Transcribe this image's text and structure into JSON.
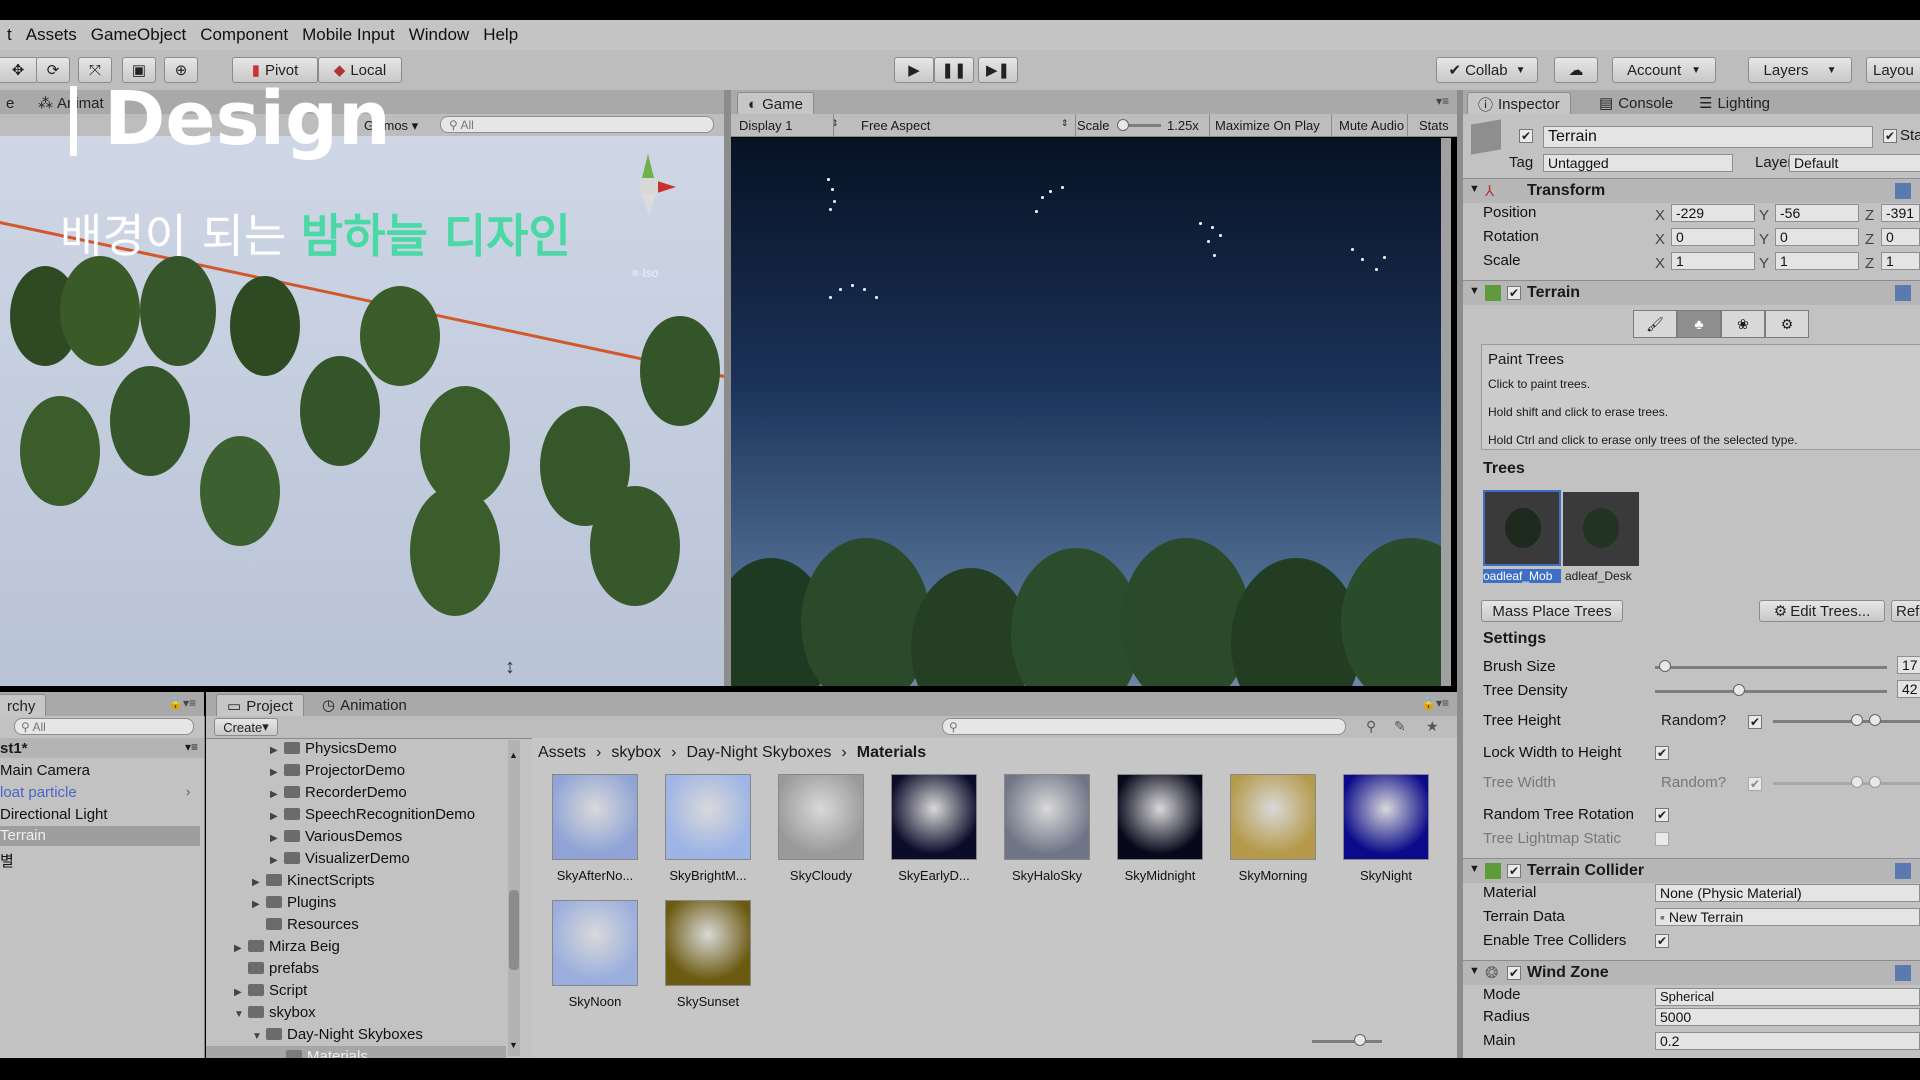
{
  "menu": [
    "t",
    "Assets",
    "GameObject",
    "Component",
    "Mobile Input",
    "Window",
    "Help"
  ],
  "toolbar": {
    "pivot": "Pivot",
    "local": "Local",
    "collab": "Collab",
    "account": "Account",
    "layers": "Layers",
    "layout": "Layou"
  },
  "scene": {
    "tab_anim": "Animat",
    "gizmos": "Gizmos",
    "search": "All",
    "iso_label": "≡ Iso"
  },
  "game": {
    "tab": "Game",
    "display": "Display 1",
    "aspect": "Free Aspect",
    "scale_label": "Scale",
    "scale_value": "1.25x",
    "maximize": "Maximize On Play",
    "mute": "Mute Audio",
    "stats": "Stats"
  },
  "overlay": {
    "title": "Design",
    "sub_plain": "배경이 되는 ",
    "sub_highlight": "밤하늘 디자인"
  },
  "inspector": {
    "tabs": [
      "Inspector",
      "Console",
      "Lighting"
    ],
    "object_name": "Terrain",
    "static_label": "Sta",
    "tag_label": "Tag",
    "tag_value": "Untagged",
    "layer_label": "Layer",
    "layer_value": "Default",
    "transform": {
      "title": "Transform",
      "position_label": "Position",
      "px": "-229",
      "py": "-56",
      "pz": "-391",
      "rotation_label": "Rotation",
      "rx": "0",
      "ry": "0",
      "rz": "0",
      "scale_label": "Scale",
      "sx": "1",
      "sy": "1",
      "sz": "1"
    },
    "terrain": {
      "title": "Terrain",
      "help_title": "Paint Trees",
      "help1": "Click to paint trees.",
      "help2": "Hold shift and click to erase trees.",
      "help3": "Hold Ctrl and click to erase only trees of the selected type.",
      "trees_header": "Trees",
      "tree1": "oadleaf_Mob",
      "tree2": "adleaf_Desk",
      "mass_place": "Mass Place Trees",
      "edit_trees": "Edit Trees...",
      "refresh": "Ref",
      "settings_header": "Settings",
      "brush_size": "Brush Size",
      "brush_value": "17",
      "density": "Tree Density",
      "density_value": "42",
      "height": "Tree Height",
      "random1": "Random?",
      "lock": "Lock Width to Height",
      "width": "Tree Width",
      "random2": "Random?",
      "rotation": "Random Tree Rotation",
      "lightmap": "Tree Lightmap Static"
    },
    "collider": {
      "title": "Terrain Collider",
      "material_label": "Material",
      "material_value": "None (Physic Material)",
      "data_label": "Terrain Data",
      "data_value": "New Terrain",
      "enable_label": "Enable Tree Colliders"
    },
    "wind": {
      "title": "Wind Zone",
      "mode_label": "Mode",
      "mode_value": "Spherical",
      "radius_label": "Radius",
      "radius_value": "5000",
      "main_label": "Main",
      "main_value": "0.2"
    }
  },
  "hierarchy": {
    "tab": "rchy",
    "search": "All",
    "scene_name": "st1*",
    "items": [
      "Main Camera",
      "loat particle",
      "Directional Light",
      "Terrain",
      "별"
    ]
  },
  "project": {
    "tabs": [
      "Project",
      "Animation"
    ],
    "create": "Create",
    "folders": [
      "PhysicsDemo",
      "ProjectorDemo",
      "RecorderDemo",
      "SpeechRecognitionDemo",
      "VariousDemos",
      "VisualizerDemo",
      "KinectScripts",
      "Plugins",
      "Resources",
      "Mirza Beig",
      "prefabs",
      "Script",
      "skybox",
      "Day-Night Skyboxes",
      "Materials"
    ],
    "breadcrumb": [
      "Assets",
      "skybox",
      "Day-Night Skyboxes",
      "Materials"
    ],
    "assets": [
      "SkyAfterNo...",
      "SkyBrightM...",
      "SkyCloudy",
      "SkyEarlyD...",
      "SkyHaloSky",
      "SkyMidnight",
      "SkyMorning",
      "SkyNight",
      "SkyNoon",
      "SkySunset"
    ],
    "asset_colors": [
      "#8fa3d6",
      "#9db4e6",
      "#9a9a9a",
      "#0b0b2a",
      "#6f7587",
      "#07081a",
      "#b49a4a",
      "#0a0a8a",
      "#9aaede",
      "#6b5a10"
    ]
  }
}
